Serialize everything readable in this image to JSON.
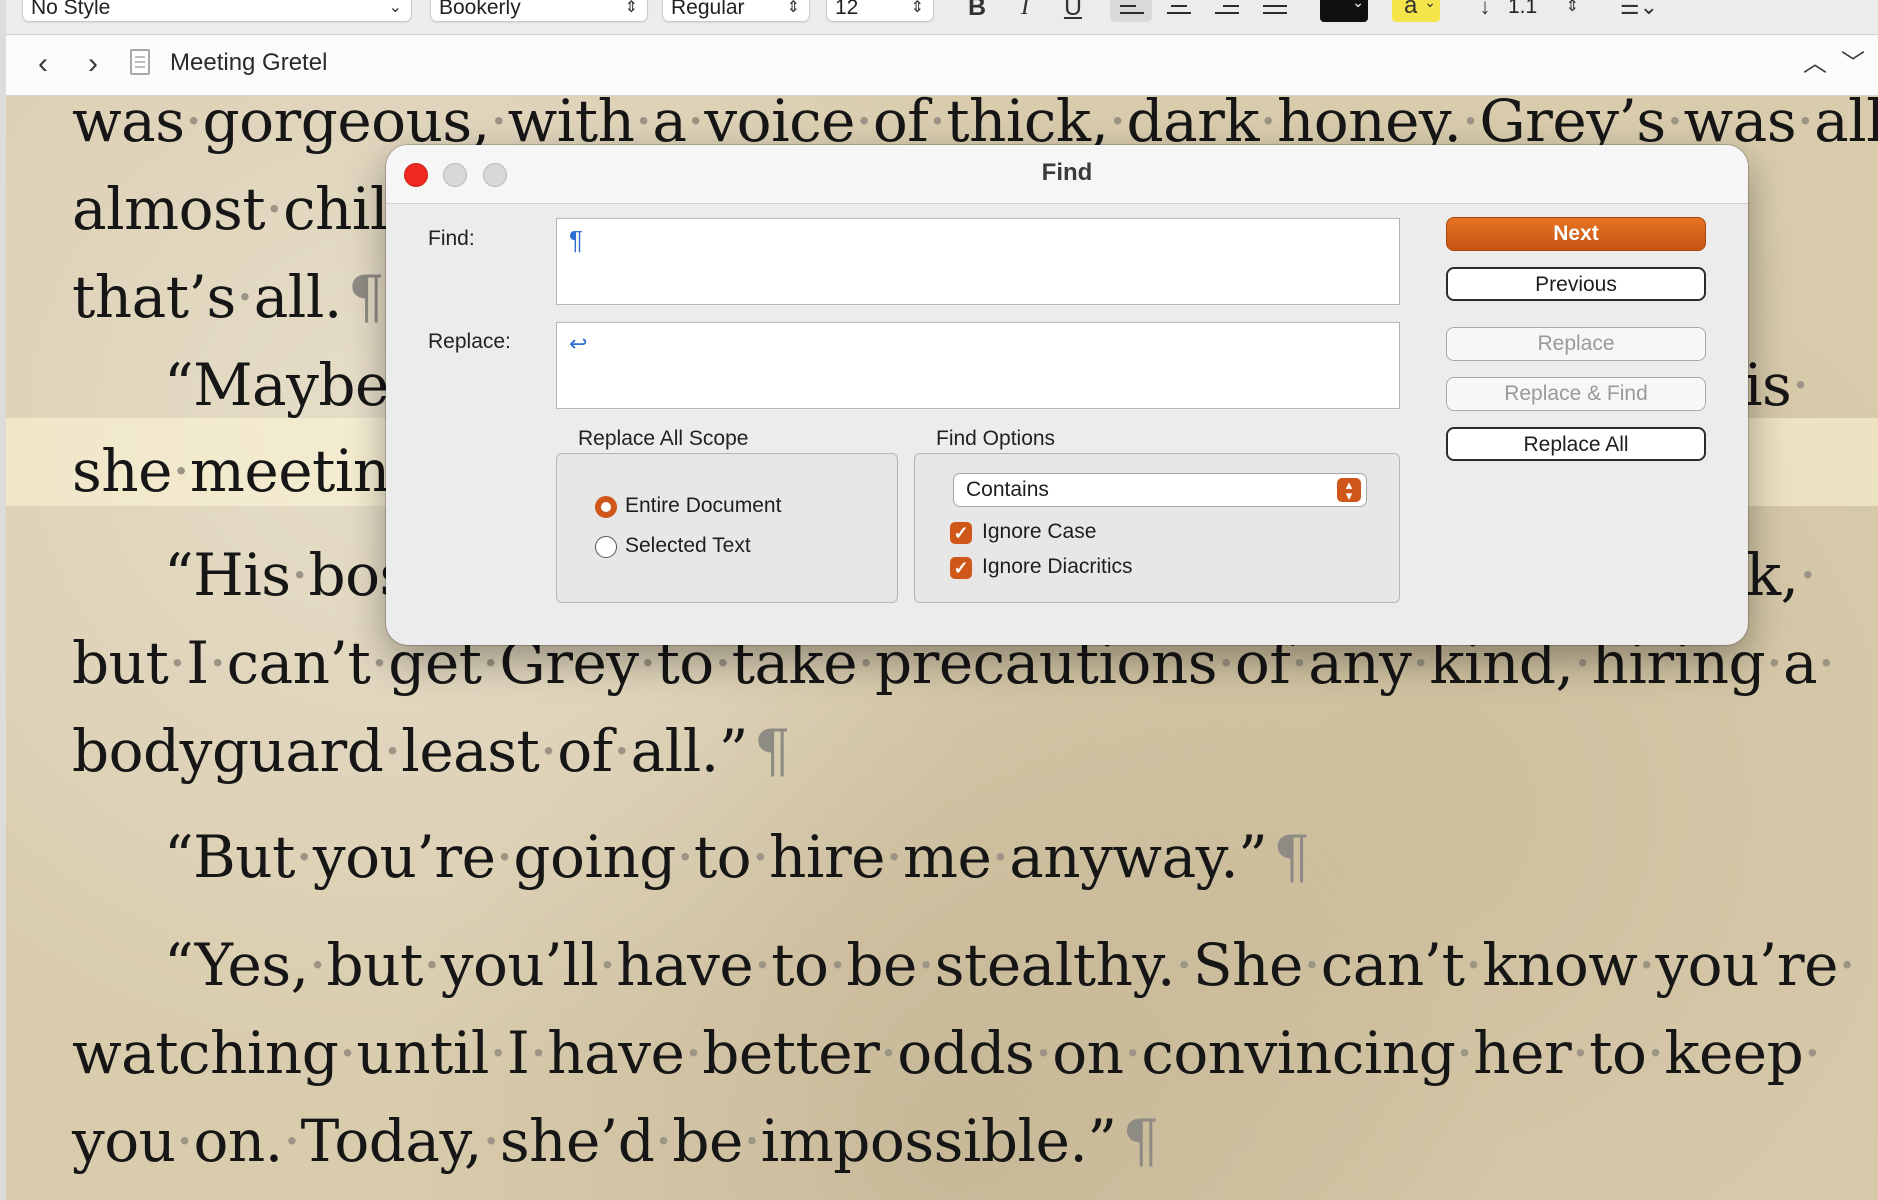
{
  "toolbar": {
    "paragraph_style": "No Style",
    "font_family": "Bookerly",
    "font_typeface": "Regular",
    "font_size": "12",
    "bold_label": "B",
    "italic_label": "I",
    "underline_label": "U",
    "text_color": "#111111",
    "highlight_label": "a",
    "line_spacing": "1.1"
  },
  "nav": {
    "back_icon": "chevron-left-icon",
    "forward_icon": "chevron-right-icon",
    "document_title": "Meeting Gretel"
  },
  "editor": {
    "lines": [
      "was·gorgeous,·with·a·voice·of·thick,·dark·honey.·Grey’s·was·all·",
      "almost·chil",
      "that’s·all.",
      "“Maybe",
      "is·",
      "she·meetin",
      "“His·bos",
      "k,·",
      "but·I·can’t·get·Grey·to·take·precautions·of·any·kind,·hiring·a·",
      "bodyguard·least·of·all.”",
      "“But·you’re·going·to·hire·me·anyway.”",
      "“Yes,·but·you’ll·have·to·be·stealthy.·She·can’t·know·you’re·",
      "watching·until·I·have·better·odds·on·convincing·her·to·keep·",
      "you·on.·Today,·she’d·be·impossible.”"
    ],
    "pilcrow": "¶"
  },
  "find_dialog": {
    "title": "Find",
    "find_label": "Find:",
    "find_value": "¶",
    "replace_label": "Replace:",
    "replace_value": "↩",
    "buttons": {
      "next": "Next",
      "previous": "Previous",
      "replace": "Replace",
      "replace_and_find": "Replace & Find",
      "replace_all": "Replace All"
    },
    "scope": {
      "label": "Replace All Scope",
      "options": [
        "Entire Document",
        "Selected Text"
      ],
      "selected": "Entire Document"
    },
    "options": {
      "label": "Find Options",
      "match_mode": "Contains",
      "ignore_case": "Ignore Case",
      "ignore_case_checked": true,
      "ignore_diacritics": "Ignore Diacritics",
      "ignore_diacritics_checked": true
    }
  },
  "colors": {
    "accent": "#d0571a",
    "default_button": "#d9621a",
    "close_light": "#f02a20",
    "paper": "#d9ccad"
  }
}
